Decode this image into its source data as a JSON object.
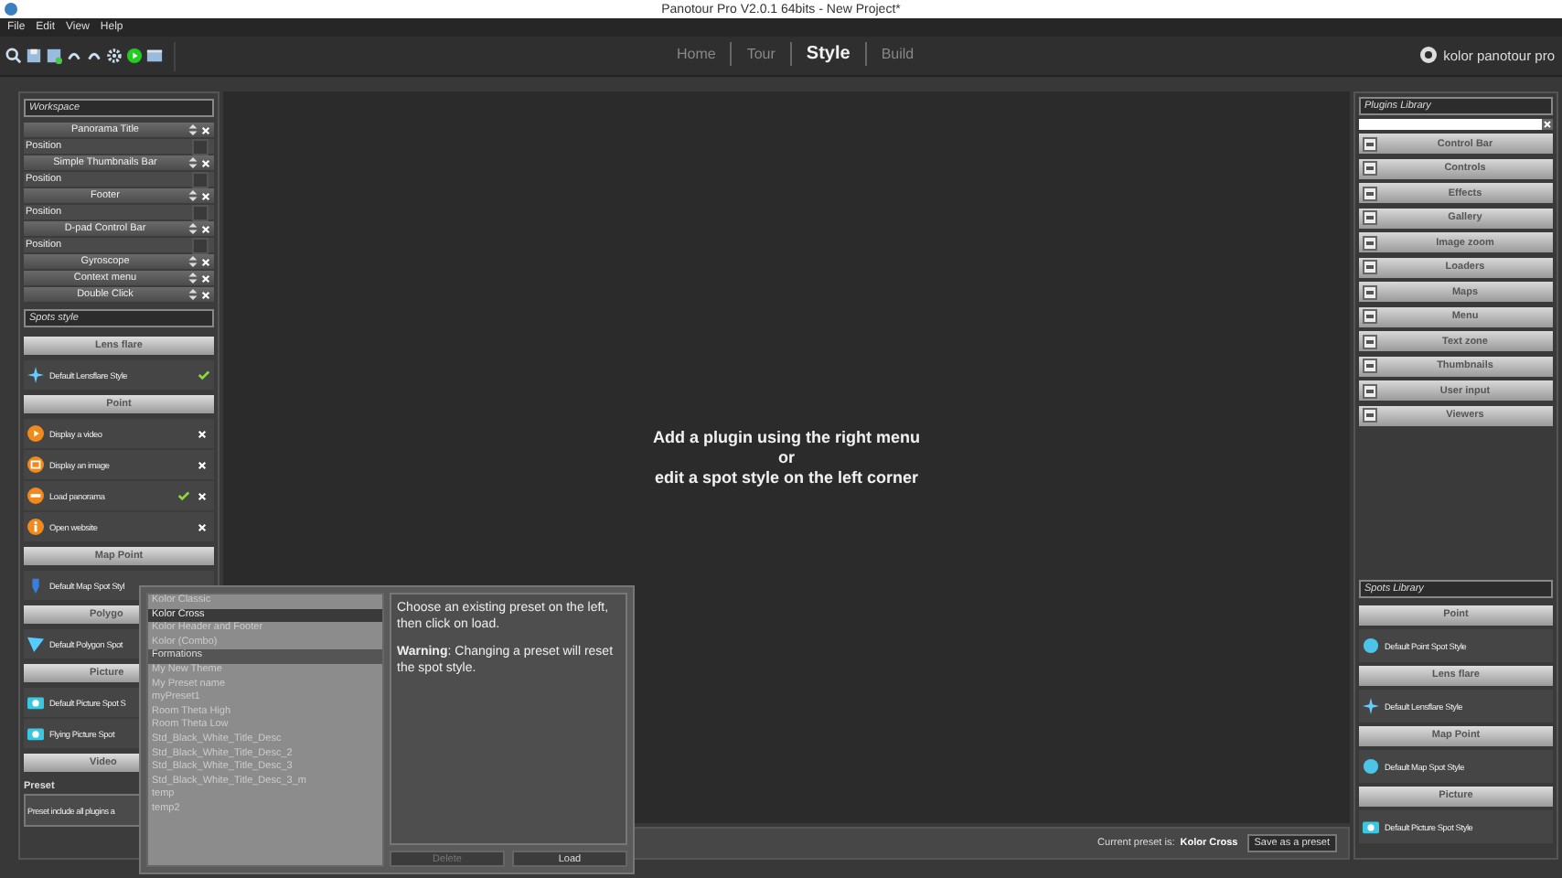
{
  "window": {
    "title": "Panotour Pro V2.0.1 64bits - New Project*"
  },
  "menu": [
    "File",
    "Edit",
    "View",
    "Help"
  ],
  "tabs": [
    {
      "label": "Home",
      "selected": false
    },
    {
      "label": "Tour",
      "selected": false
    },
    {
      "label": "Style",
      "selected": true
    },
    {
      "label": "Build",
      "selected": false
    }
  ],
  "logo": {
    "text": "kolor panotour pro"
  },
  "workspace": {
    "title": "Workspace",
    "items": [
      {
        "name": "Panorama Title",
        "position": "Position"
      },
      {
        "name": "Simple Thumbnails Bar",
        "position": "Position"
      },
      {
        "name": "Footer",
        "position": "Position"
      },
      {
        "name": "D-pad Control Bar",
        "position": "Position"
      },
      {
        "name": "Gyroscope"
      },
      {
        "name": "Context menu"
      },
      {
        "name": "Double Click"
      }
    ]
  },
  "spots_style": {
    "title": "Spots style",
    "sections": [
      {
        "title": "Lens flare",
        "covered": false,
        "items": [
          {
            "label": "Default Lensflare Style",
            "kind": "flare",
            "checked": true,
            "removable": false
          }
        ]
      },
      {
        "title": "Point",
        "covered": false,
        "items": [
          {
            "label": "Display a video",
            "kind": "video",
            "checked": false,
            "removable": true
          },
          {
            "label": "Display an image",
            "kind": "image",
            "checked": false,
            "removable": true
          },
          {
            "label": "Load panorama",
            "kind": "panorama",
            "checked": true,
            "removable": true
          },
          {
            "label": "Open website",
            "kind": "info",
            "checked": false,
            "removable": true
          }
        ]
      },
      {
        "title": "Map Point",
        "covered": false,
        "items": [
          {
            "label": "Default Map Spot Styl",
            "kind": "pin",
            "checked": false,
            "removable": false
          }
        ]
      },
      {
        "title": "Polygo",
        "covered": true,
        "items": [
          {
            "label": "Default Polygon Spot",
            "kind": "polygon",
            "checked": false,
            "removable": false
          }
        ]
      },
      {
        "title": "Picture",
        "covered": true,
        "items": [
          {
            "label": "Default Picture Spot S",
            "kind": "camera",
            "checked": false,
            "removable": false
          },
          {
            "label": "Flying Picture Spot",
            "kind": "camera",
            "checked": false,
            "removable": false
          }
        ]
      },
      {
        "title": "Video",
        "covered": true
      }
    ]
  },
  "preset": {
    "label": "Preset",
    "description": "Preset include all plugins a"
  },
  "canvas": {
    "lines": [
      "Add a plugin using the right menu",
      "or",
      "edit a spot style on the left corner"
    ]
  },
  "bottom_bar": {
    "label": "Current preset is:",
    "current": "Kolor Cross",
    "button": "Save as a preset"
  },
  "preset_dialog": {
    "presets": [
      {
        "name": "Kolor Classic",
        "selected": false,
        "hovered": false
      },
      {
        "name": "Kolor Cross",
        "selected": true,
        "hovered": false
      },
      {
        "name": "Kolor Header and Footer",
        "selected": false,
        "hovered": false
      },
      {
        "name": "Kolor (Combo)",
        "selected": false,
        "hovered": false
      },
      {
        "name": "Formations",
        "selected": false,
        "hovered": true
      },
      {
        "name": "My New Theme",
        "selected": false,
        "hovered": false
      },
      {
        "name": "My Preset name",
        "selected": false,
        "hovered": false
      },
      {
        "name": "myPreset1",
        "selected": false,
        "hovered": false
      },
      {
        "name": "Room Theta High",
        "selected": false,
        "hovered": false
      },
      {
        "name": "Room Theta Low",
        "selected": false,
        "hovered": false
      },
      {
        "name": "Std_Black_White_Title_Desc",
        "selected": false,
        "hovered": false
      },
      {
        "name": "Std_Black_White_Title_Desc_2",
        "selected": false,
        "hovered": false
      },
      {
        "name": "Std_Black_White_Title_Desc_3",
        "selected": false,
        "hovered": false
      },
      {
        "name": "Std_Black_White_Title_Desc_3_m",
        "selected": false,
        "hovered": false
      },
      {
        "name": "temp",
        "selected": false,
        "hovered": false
      },
      {
        "name": "temp2",
        "selected": false,
        "hovered": false
      }
    ],
    "help": "Choose an existing preset on the left, then click on load.",
    "warning": "**Warning**: Changing a preset will reset the spot style.",
    "buttons": [
      {
        "label": "Delete",
        "disabled": true
      },
      {
        "label": "Load",
        "disabled": false
      }
    ]
  },
  "plugins_library": {
    "title": "Plugins Library",
    "items": [
      "Control Bar",
      "Controls",
      "Effects",
      "Gallery",
      "Image zoom",
      "Loaders",
      "Maps",
      "Menu",
      "Text zone",
      "Thumbnails",
      "User input",
      "Viewers"
    ]
  },
  "spots_library": {
    "title": "Spots Library",
    "sections": [
      {
        "title": "Point",
        "items": [
          {
            "label": "Default Point Spot Style",
            "kind": "ball"
          }
        ]
      },
      {
        "title": "Lens flare",
        "items": [
          {
            "label": "Default Lensflare Style",
            "kind": "flare"
          }
        ]
      },
      {
        "title": "Map Point",
        "items": [
          {
            "label": "Default Map Spot Style",
            "kind": "ball"
          }
        ]
      },
      {
        "title": "Picture",
        "items": [
          {
            "label": "Default Picture Spot Style",
            "kind": "camera"
          }
        ]
      }
    ]
  }
}
